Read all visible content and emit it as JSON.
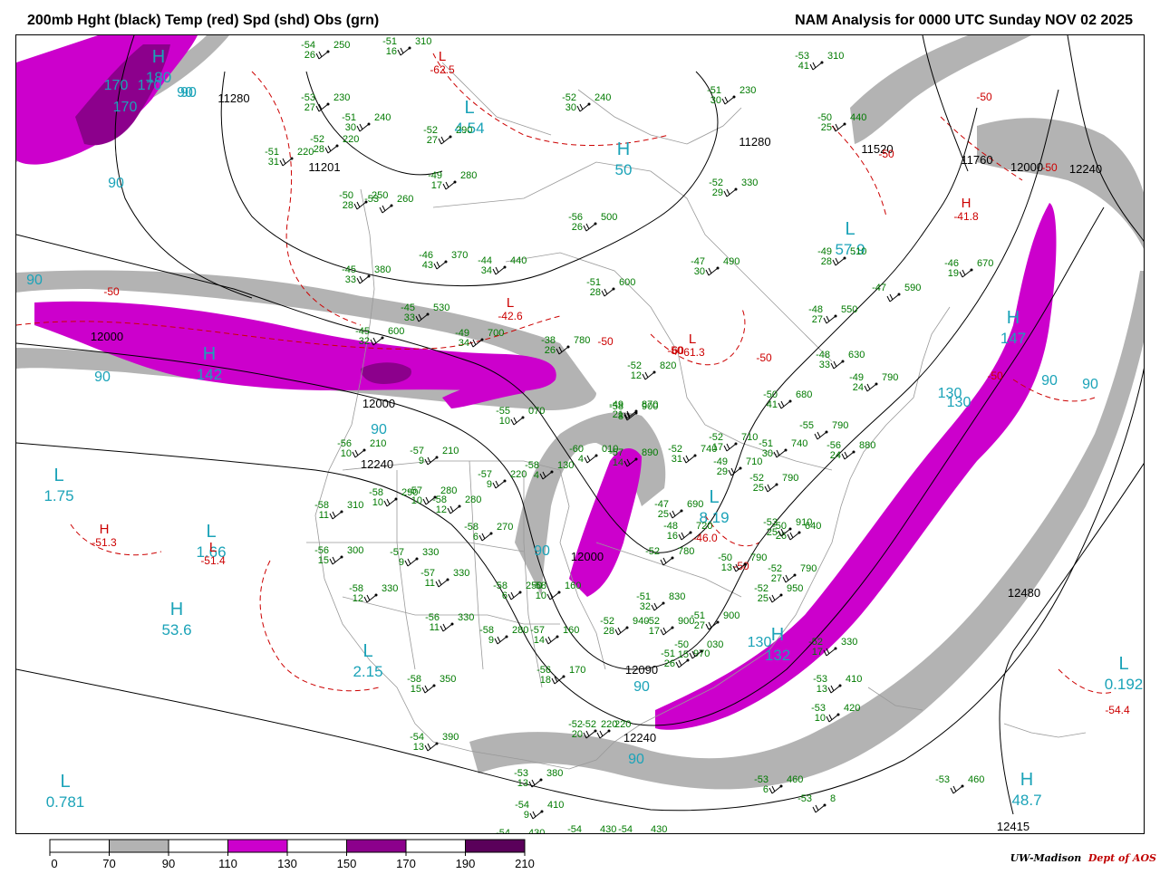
{
  "header": {
    "left": "200mb Hght (black) Temp (red) Spd (shd) Obs (grn)",
    "right": "NAM Analysis for 0000 UTC Sunday  NOV 02 2025"
  },
  "credit": {
    "org": "UW-Madison",
    "dept": "Dept of AOS"
  },
  "colors": {
    "speed_70": "#b3b3b3",
    "speed_110": "#cc00cc",
    "speed_150": "#8c008c",
    "speed_190": "#5a005a",
    "height": "#000000",
    "temp": "#cc0000",
    "obs": "#007a00",
    "hl_blue": "#1ba3b8",
    "coast": "#999999"
  },
  "legend": {
    "thresholds": [
      "0",
      "70",
      "90",
      "110",
      "130",
      "150",
      "170",
      "190",
      "210"
    ],
    "fills": [
      "#ffffff",
      "#b3b3b3",
      "#ffffff",
      "#cc00cc",
      "#ffffff",
      "#8c008c",
      "#ffffff",
      "#5a005a"
    ]
  },
  "centers": [
    {
      "label": "L",
      "value": "1.75"
    },
    {
      "label": "L",
      "value": "1.66"
    },
    {
      "label": "H",
      "value": "53.6"
    },
    {
      "label": "L",
      "value": "2.15"
    },
    {
      "label": "L",
      "value": "0.781"
    },
    {
      "label": "L",
      "value": "4.54"
    },
    {
      "label": "H",
      "value": "50"
    },
    {
      "label": "L",
      "value": "57.9"
    },
    {
      "label": "H",
      "value": "142"
    },
    {
      "label": "H",
      "value": "147"
    },
    {
      "label": "H",
      "value": "180"
    },
    {
      "label": "L",
      "value": "0.192"
    },
    {
      "label": "H",
      "value": "48.7"
    },
    {
      "label": "L",
      "value": "8.19"
    },
    {
      "label": "H",
      "value": "132"
    }
  ],
  "temp_centers": [
    {
      "label": "H",
      "value": "-51.3"
    },
    {
      "label": "L",
      "value": "-51.4"
    },
    {
      "label": "L",
      "value": "-42.6"
    },
    {
      "label": "L",
      "value": "-61.3"
    },
    {
      "label": "L",
      "value": "-62.5"
    },
    {
      "label": "H",
      "value": "-41.8"
    },
    {
      "label": "",
      "value": "-54.4"
    },
    {
      "label": "",
      "value": "-46.0"
    }
  ],
  "height_labels": [
    "11201",
    "11520",
    "11280",
    "11760",
    "12000",
    "12240",
    "12000",
    "12000",
    "12240",
    "12480",
    "12000",
    "12090",
    "12240",
    "12415",
    "11280"
  ],
  "speed_labels": [
    "170",
    "170",
    "170",
    "90",
    "90",
    "90",
    "90",
    "90",
    "90",
    "90",
    "90",
    "90",
    "130",
    "130",
    "130",
    "90",
    "90"
  ],
  "temp_labels": [
    "-50",
    "-50",
    "-50",
    "-50",
    "-50",
    "-60",
    "-50",
    "-50",
    "-50",
    "-50"
  ],
  "obs": [
    {
      "t": "-54",
      "h": "250",
      "d": "26"
    },
    {
      "t": "-51",
      "h": "310",
      "d": "16"
    },
    {
      "t": "-53",
      "h": "230",
      "d": "27"
    },
    {
      "t": "-51",
      "h": "240",
      "d": "30"
    },
    {
      "t": "-52",
      "h": "220",
      "d": "28"
    },
    {
      "t": "-51",
      "h": "220",
      "d": "31"
    },
    {
      "t": "-52",
      "h": "290",
      "d": "27"
    },
    {
      "t": "-49",
      "h": "280",
      "d": "17"
    },
    {
      "t": "-50",
      "h": "250",
      "d": "28"
    },
    {
      "t": "-53",
      "h": "260",
      "d": ""
    },
    {
      "t": "-46",
      "h": "370",
      "d": "43"
    },
    {
      "t": "-44",
      "h": "440",
      "d": "34"
    },
    {
      "t": "-45",
      "h": "380",
      "d": "33"
    },
    {
      "t": "-56",
      "h": "500",
      "d": "26"
    },
    {
      "t": "-51",
      "h": "600",
      "d": "28"
    },
    {
      "t": "-52",
      "h": "240",
      "d": "30"
    },
    {
      "t": "-51",
      "h": "230",
      "d": "30"
    },
    {
      "t": "-53",
      "h": "310",
      "d": "41"
    },
    {
      "t": "-50",
      "h": "440",
      "d": "25"
    },
    {
      "t": "-52",
      "h": "330",
      "d": "29"
    },
    {
      "t": "-47",
      "h": "490",
      "d": "30"
    },
    {
      "t": "-49",
      "h": "510",
      "d": "28"
    },
    {
      "t": "-46",
      "h": "670",
      "d": "19"
    },
    {
      "t": "-47",
      "h": "590",
      "d": ""
    },
    {
      "t": "-48",
      "h": "550",
      "d": "27"
    },
    {
      "t": "-48",
      "h": "630",
      "d": "33"
    },
    {
      "t": "-49",
      "h": "790",
      "d": "24"
    },
    {
      "t": "-50",
      "h": "680",
      "d": "41"
    },
    {
      "t": "-55",
      "h": "790",
      "d": ""
    },
    {
      "t": "-56",
      "h": "880",
      "d": "24"
    },
    {
      "t": "-50",
      "h": "640",
      "d": "26"
    },
    {
      "t": "-45",
      "h": "530",
      "d": "33"
    },
    {
      "t": "-45",
      "h": "600",
      "d": "32"
    },
    {
      "t": "-49",
      "h": "700",
      "d": "34"
    },
    {
      "t": "-38",
      "h": "780",
      "d": "26"
    },
    {
      "t": "-52",
      "h": "820",
      "d": "12"
    },
    {
      "t": "-49",
      "h": "870",
      "d": "21"
    },
    {
      "t": "-55",
      "h": "070",
      "d": "10"
    },
    {
      "t": "-58",
      "h": "900",
      "d": "8"
    },
    {
      "t": "-57",
      "h": "890",
      "d": "14"
    },
    {
      "t": "-52",
      "h": "740",
      "d": "31"
    },
    {
      "t": "-52",
      "h": "710",
      "d": "17"
    },
    {
      "t": "-51",
      "h": "740",
      "d": "30"
    },
    {
      "t": "-49",
      "h": "710",
      "d": "29"
    },
    {
      "t": "-52",
      "h": "790",
      "d": "25"
    },
    {
      "t": "-56",
      "h": "210",
      "d": "10"
    },
    {
      "t": "-57",
      "h": "210",
      "d": "9"
    },
    {
      "t": "-57",
      "h": "220",
      "d": "9"
    },
    {
      "t": "-58",
      "h": "130",
      "d": "4"
    },
    {
      "t": "-60",
      "h": "010",
      "d": "4"
    },
    {
      "t": "-58",
      "h": "290",
      "d": "10"
    },
    {
      "t": "-57",
      "h": "280",
      "d": "10"
    },
    {
      "t": "-58",
      "h": "280",
      "d": "12"
    },
    {
      "t": "-58",
      "h": "310",
      "d": "11"
    },
    {
      "t": "-58",
      "h": "270",
      "d": "6"
    },
    {
      "t": "-56",
      "h": "300",
      "d": "15"
    },
    {
      "t": "-57",
      "h": "330",
      "d": "9"
    },
    {
      "t": "-57",
      "h": "330",
      "d": "11"
    },
    {
      "t": "-58",
      "h": "330",
      "d": "12"
    },
    {
      "t": "-58",
      "h": "250",
      "d": "6"
    },
    {
      "t": "-58",
      "h": "160",
      "d": "10"
    },
    {
      "t": "-57",
      "h": "160",
      "d": "14"
    },
    {
      "t": "-56",
      "h": "330",
      "d": "11"
    },
    {
      "t": "-58",
      "h": "280",
      "d": "9"
    },
    {
      "t": "-56",
      "h": "170",
      "d": "18"
    },
    {
      "t": "-58",
      "h": "350",
      "d": "15"
    },
    {
      "t": "-54",
      "h": "390",
      "d": "13"
    },
    {
      "t": "-53",
      "h": "380",
      "d": "13"
    },
    {
      "t": "-54",
      "h": "410",
      "d": "9"
    },
    {
      "t": "-54",
      "h": "430",
      "d": ""
    },
    {
      "t": "-54",
      "h": "430",
      "d": ""
    },
    {
      "t": "-54",
      "h": "430",
      "d": ""
    },
    {
      "t": "-53",
      "h": "460",
      "d": "6"
    },
    {
      "t": "-53",
      "h": "460",
      "d": ""
    },
    {
      "t": "-53",
      "h": "8",
      "d": ""
    },
    {
      "t": "-53",
      "h": "410",
      "d": "13"
    },
    {
      "t": "-53",
      "h": "420",
      "d": "10"
    },
    {
      "t": "-52",
      "h": "330",
      "d": "17"
    },
    {
      "t": "-53",
      "h": "910",
      "d": "25"
    },
    {
      "t": "-52",
      "h": "790",
      "d": "27"
    },
    {
      "t": "-50",
      "h": "790",
      "d": "13"
    },
    {
      "t": "-51",
      "h": "830",
      "d": "32"
    },
    {
      "t": "-52",
      "h": "780",
      "d": ""
    },
    {
      "t": "-52",
      "h": "950",
      "d": "25"
    },
    {
      "t": "-51",
      "h": "900",
      "d": "27"
    },
    {
      "t": "-52",
      "h": "940",
      "d": "28"
    },
    {
      "t": "-52",
      "h": "900",
      "d": "17"
    },
    {
      "t": "-51",
      "h": "970",
      "d": "26"
    },
    {
      "t": "-50",
      "h": "030",
      "d": "15"
    },
    {
      "t": "-52",
      "h": "220",
      "d": "20"
    },
    {
      "t": "-52",
      "h": "220",
      "d": ""
    },
    {
      "t": "-47",
      "h": "690",
      "d": "25"
    },
    {
      "t": "-48",
      "h": "720",
      "d": "16"
    }
  ]
}
